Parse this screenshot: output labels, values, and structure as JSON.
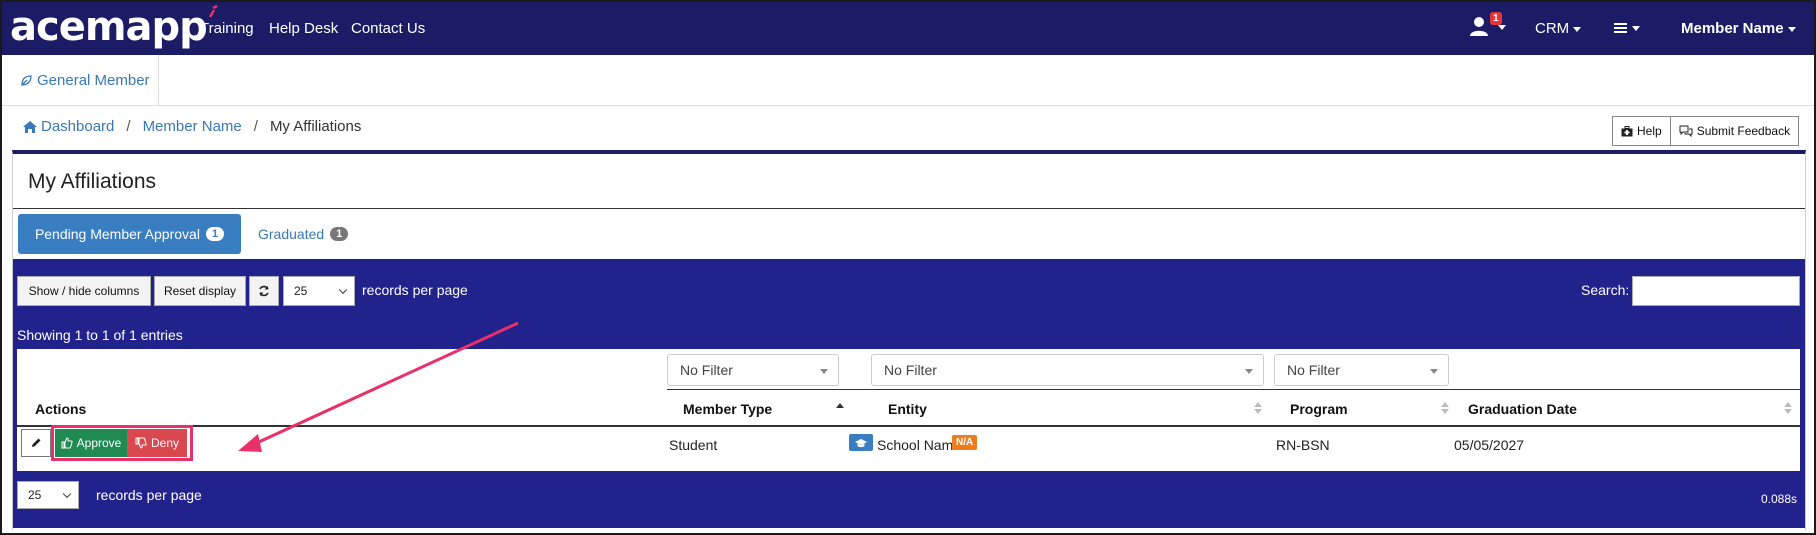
{
  "nav": {
    "logo": "acemapp",
    "links": [
      "Training",
      "Help Desk",
      "Contact Us"
    ],
    "notification_count": "1",
    "crm_label": "CRM",
    "member_label": "Member Name"
  },
  "subheader": {
    "tab_label": "General Member"
  },
  "breadcrumb": {
    "home": "Dashboard",
    "member": "Member Name",
    "current": "My Affiliations"
  },
  "help": {
    "help_label": "Help",
    "feedback_label": "Submit Feedback"
  },
  "panel": {
    "title": "My Affiliations",
    "tabs": [
      {
        "label": "Pending Member Approval",
        "count": "1"
      },
      {
        "label": "Graduated",
        "count": "1"
      }
    ]
  },
  "controls": {
    "show_hide": "Show / hide columns",
    "reset": "Reset display",
    "page_size": "25",
    "records_per_page": "records per page",
    "search_label": "Search:",
    "search_value": "",
    "showing": "Showing 1 to 1 of 1 entries"
  },
  "table": {
    "filter_placeholder": "No Filter",
    "headers": [
      "Actions",
      "Member Type",
      "Entity",
      "Program",
      "Graduation Date"
    ],
    "row": {
      "approve": "Approve",
      "deny": "Deny",
      "member_type": "Student",
      "entity": "School Name",
      "entity_badge": "N/A",
      "program": "RN-BSN",
      "graduation_date": "05/05/2027"
    }
  },
  "footer": {
    "page_size": "25",
    "records_per_page": "records per page",
    "timing": "0.088s"
  },
  "colors": {
    "nav": "#1c1c66",
    "table_bg": "#22228c",
    "primary": "#3a7ec2",
    "approve": "#1f8a52",
    "deny": "#d9474f",
    "highlight": "#e8306a",
    "badge_orange": "#ef7d20"
  }
}
